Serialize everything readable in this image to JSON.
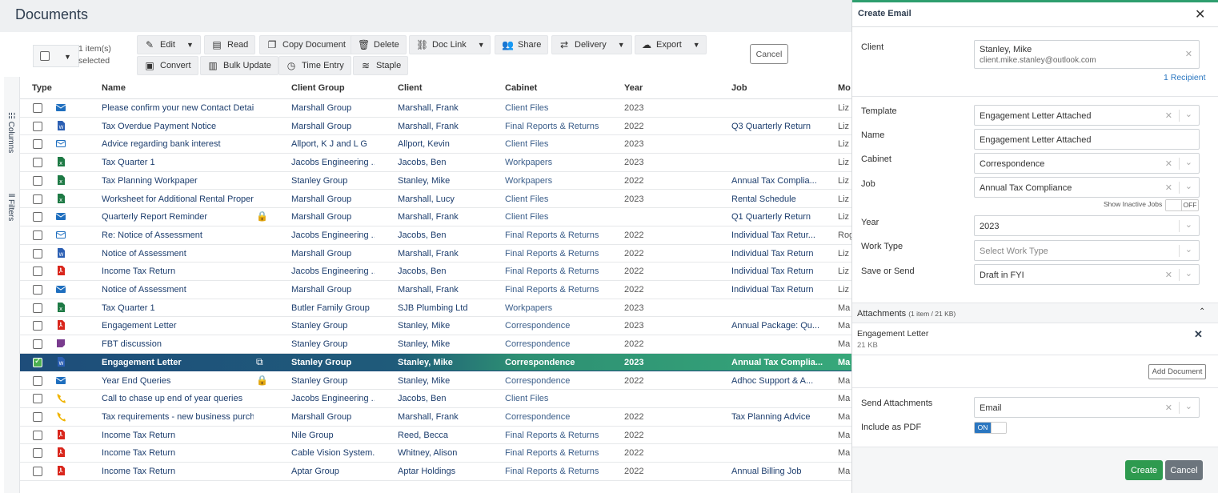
{
  "page": {
    "title": "Documents"
  },
  "toolbar": {
    "selection": "1 item(s) selected",
    "edit": "Edit",
    "read": "Read",
    "copy": "Copy Document",
    "delete": "Delete",
    "doc_link": "Doc Link",
    "share": "Share",
    "delivery": "Delivery",
    "export": "Export",
    "convert": "Convert",
    "bulk_update": "Bulk Update",
    "time_entry": "Time Entry",
    "staple": "Staple",
    "cancel": "Cancel"
  },
  "side": {
    "columns": "Columns",
    "filters": "Filters"
  },
  "grid": {
    "headers": {
      "type": "Type",
      "name": "Name",
      "client_group": "Client Group",
      "client": "Client",
      "cabinet": "Cabinet",
      "year": "Year",
      "job": "Job",
      "more": "Mo"
    },
    "rows": [
      {
        "icon": "envelope-filled-icon",
        "name": "Please confirm your new Contact Details",
        "group": "Marshall Group",
        "client": "Marshall, Frank",
        "cabinet": "Client Files",
        "year": "2023",
        "job": "",
        "mo": "Liz"
      },
      {
        "icon": "word-doc-icon",
        "name": "Tax Overdue Payment Notice",
        "group": "Marshall Group",
        "client": "Marshall, Frank",
        "cabinet": "Final Reports & Returns",
        "year": "2022",
        "job": "Q3 Quarterly Return",
        "mo": "Liz"
      },
      {
        "icon": "envelope-outline-icon",
        "name": "Advice regarding bank interest",
        "group": "Allport, K J and L G",
        "client": "Allport, Kevin",
        "cabinet": "Client Files",
        "year": "2023",
        "job": "",
        "mo": "Liz"
      },
      {
        "icon": "excel-doc-icon",
        "name": "Tax Quarter 1",
        "group": "Jacobs Engineering ...",
        "client": "Jacobs, Ben",
        "cabinet": "Workpapers",
        "year": "2023",
        "job": "",
        "mo": "Liz"
      },
      {
        "icon": "excel-doc-icon",
        "name": "Tax Planning Workpaper",
        "group": "Stanley Group",
        "client": "Stanley, Mike",
        "cabinet": "Workpapers",
        "year": "2022",
        "job": "Annual Tax Complia...",
        "mo": "Liz"
      },
      {
        "icon": "excel-doc-icon",
        "name": "Worksheet for Additional Rental Property",
        "group": "Marshall Group",
        "client": "Marshall, Lucy",
        "cabinet": "Client Files",
        "year": "2023",
        "job": "Rental Schedule",
        "mo": "Liz"
      },
      {
        "icon": "envelope-filled-icon",
        "name": "Quarterly Report Reminder",
        "group": "Marshall Group",
        "client": "Marshall, Frank",
        "cabinet": "Client Files",
        "year": "",
        "job": "Q1 Quarterly Return",
        "mo": "Liz",
        "right": "lock-icon"
      },
      {
        "icon": "envelope-outline-icon",
        "name": "Re: Notice of Assessment",
        "group": "Jacobs Engineering ...",
        "client": "Jacobs, Ben",
        "cabinet": "Final Reports & Returns",
        "year": "2022",
        "job": "Individual Tax Retur...",
        "mo": "Rog"
      },
      {
        "icon": "word-doc-icon",
        "name": "Notice of Assessment",
        "group": "Marshall Group",
        "client": "Marshall, Frank",
        "cabinet": "Final Reports & Returns",
        "year": "2022",
        "job": "Individual Tax Return",
        "mo": "Liz"
      },
      {
        "icon": "pdf-doc-icon",
        "name": "Income Tax Return",
        "group": "Jacobs Engineering ...",
        "client": "Jacobs, Ben",
        "cabinet": "Final Reports & Returns",
        "year": "2022",
        "job": "Individual Tax Return",
        "mo": "Liz"
      },
      {
        "icon": "envelope-filled-icon",
        "name": "Notice of Assessment",
        "group": "Marshall Group",
        "client": "Marshall, Frank",
        "cabinet": "Final Reports & Returns",
        "year": "2022",
        "job": "Individual Tax Return",
        "mo": "Liz"
      },
      {
        "icon": "excel-doc-icon",
        "name": "Tax Quarter 1",
        "group": "Butler Family Group",
        "client": "SJB Plumbing Ltd",
        "cabinet": "Workpapers",
        "year": "2023",
        "job": "",
        "mo": "Ma"
      },
      {
        "icon": "pdf-doc-icon",
        "name": "Engagement Letter",
        "group": "Stanley Group",
        "client": "Stanley, Mike",
        "cabinet": "Correspondence",
        "year": "2023",
        "job": "Annual Package: Qu...",
        "mo": "Ma"
      },
      {
        "icon": "note-icon",
        "name": "FBT discussion",
        "group": "Stanley Group",
        "client": "Stanley, Mike",
        "cabinet": "Correspondence",
        "year": "2022",
        "job": "",
        "mo": "Ma"
      },
      {
        "icon": "word-doc-icon",
        "name": "Engagement Letter",
        "group": "Stanley Group",
        "client": "Stanley, Mike",
        "cabinet": "Correspondence",
        "year": "2023",
        "job": "Annual Tax Complia...",
        "mo": "Ma",
        "right": "external-link-icon",
        "selected": true
      },
      {
        "icon": "envelope-filled-icon",
        "name": "Year End Queries",
        "group": "Stanley Group",
        "client": "Stanley, Mike",
        "cabinet": "Correspondence",
        "year": "2022",
        "job": "Adhoc Support & A...",
        "mo": "Ma",
        "right": "lock-icon"
      },
      {
        "icon": "phone-icon",
        "name": "Call to chase up end of year queries",
        "group": "Jacobs Engineering ...",
        "client": "Jacobs, Ben",
        "cabinet": "Client Files",
        "year": "",
        "job": "",
        "mo": "Ma"
      },
      {
        "icon": "phone-icon",
        "name": "Tax requirements - new business purchase",
        "group": "Marshall Group",
        "client": "Marshall, Frank",
        "cabinet": "Correspondence",
        "year": "2022",
        "job": "Tax Planning Advice",
        "mo": "Ma"
      },
      {
        "icon": "pdf-doc-icon",
        "name": "Income Tax Return",
        "group": "Nile Group",
        "client": "Reed, Becca",
        "cabinet": "Final Reports & Returns",
        "year": "2022",
        "job": "",
        "mo": "Ma"
      },
      {
        "icon": "pdf-doc-icon",
        "name": "Income Tax Return",
        "group": "Cable Vision System...",
        "client": "Whitney, Alison",
        "cabinet": "Final Reports & Returns",
        "year": "2022",
        "job": "",
        "mo": "Ma"
      },
      {
        "icon": "pdf-doc-icon",
        "name": "Income Tax Return",
        "group": "Aptar Group",
        "client": "Aptar Holdings",
        "cabinet": "Final Reports & Returns",
        "year": "2022",
        "job": "Annual Billing Job",
        "mo": "Ma"
      }
    ]
  },
  "panel": {
    "title": "Create Email",
    "client_label": "Client",
    "client_name": "Stanley, Mike",
    "client_email": "client.mike.stanley@outlook.com",
    "recipients": "1 Recipient",
    "template_label": "Template",
    "template_value": "Engagement Letter Attached",
    "name_label": "Name",
    "name_value": "Engagement Letter Attached",
    "cabinet_label": "Cabinet",
    "cabinet_value": "Correspondence",
    "job_label": "Job",
    "job_value": "Annual Tax Compliance",
    "inactive_label": "Show Inactive Jobs",
    "inactive_value": "OFF",
    "year_label": "Year",
    "year_value": "2023",
    "worktype_label": "Work Type",
    "worktype_placeholder": "Select Work Type",
    "save_label": "Save or Send",
    "save_value": "Draft in FYI",
    "attachments_label": "Attachments",
    "attachments_summary": "(1 item / 21 KB)",
    "attachment_name": "Engagement Letter",
    "attachment_size": "21 KB",
    "add_document": "Add Document",
    "send_att_label": "Send Attachments",
    "send_att_value": "Email",
    "pdf_label": "Include as PDF",
    "pdf_value": "ON",
    "create": "Create",
    "cancel": "Cancel"
  },
  "colors": {
    "accent_green": "#2e9a4f",
    "selected_blue": "#1e4d7a",
    "link_blue": "#2a76c0"
  }
}
